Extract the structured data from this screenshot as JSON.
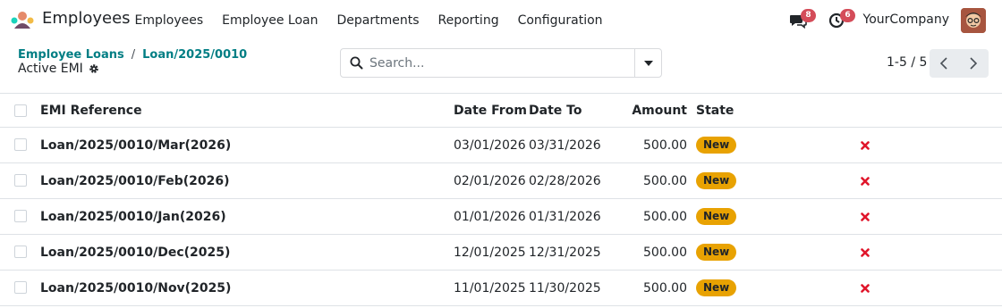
{
  "navbar": {
    "app_name": "Employees",
    "menu": [
      "Employees",
      "Employee Loan",
      "Departments",
      "Reporting",
      "Configuration"
    ],
    "messages_count": "8",
    "activities_count": "6",
    "company": "YourCompany"
  },
  "control": {
    "breadcrumb": [
      "Employee Loans",
      "Loan/2025/0010"
    ],
    "subtitle": "Active EMI",
    "search_placeholder": "Search...",
    "pager": "1-5 / 5"
  },
  "table": {
    "headers": {
      "ref": "EMI Reference",
      "date_from": "Date From",
      "date_to": "Date To",
      "amount": "Amount",
      "state": "State"
    },
    "rows": [
      {
        "ref": "Loan/2025/0010/Mar(2026)",
        "date_from": "03/01/2026",
        "date_to": "03/31/2026",
        "amount": "500.00",
        "state": "New"
      },
      {
        "ref": "Loan/2025/0010/Feb(2026)",
        "date_from": "02/01/2026",
        "date_to": "02/28/2026",
        "amount": "500.00",
        "state": "New"
      },
      {
        "ref": "Loan/2025/0010/Jan(2026)",
        "date_from": "01/01/2026",
        "date_to": "01/31/2026",
        "amount": "500.00",
        "state": "New"
      },
      {
        "ref": "Loan/2025/0010/Dec(2025)",
        "date_from": "12/01/2025",
        "date_to": "12/31/2025",
        "amount": "500.00",
        "state": "New"
      },
      {
        "ref": "Loan/2025/0010/Nov(2025)",
        "date_from": "11/01/2025",
        "date_to": "11/30/2025",
        "amount": "500.00",
        "state": "New"
      }
    ]
  },
  "colors": {
    "accent": "#017e84",
    "badge": "#d44c59",
    "state_new": "#e8a202",
    "delete": "#e0162b"
  },
  "icons": {
    "app": "employees-app-icon",
    "messages": "chat-icon",
    "activities": "clock-icon",
    "settings": "gear-icon",
    "search": "search-icon",
    "dropdown": "caret-down-icon",
    "delete": "close-icon"
  }
}
